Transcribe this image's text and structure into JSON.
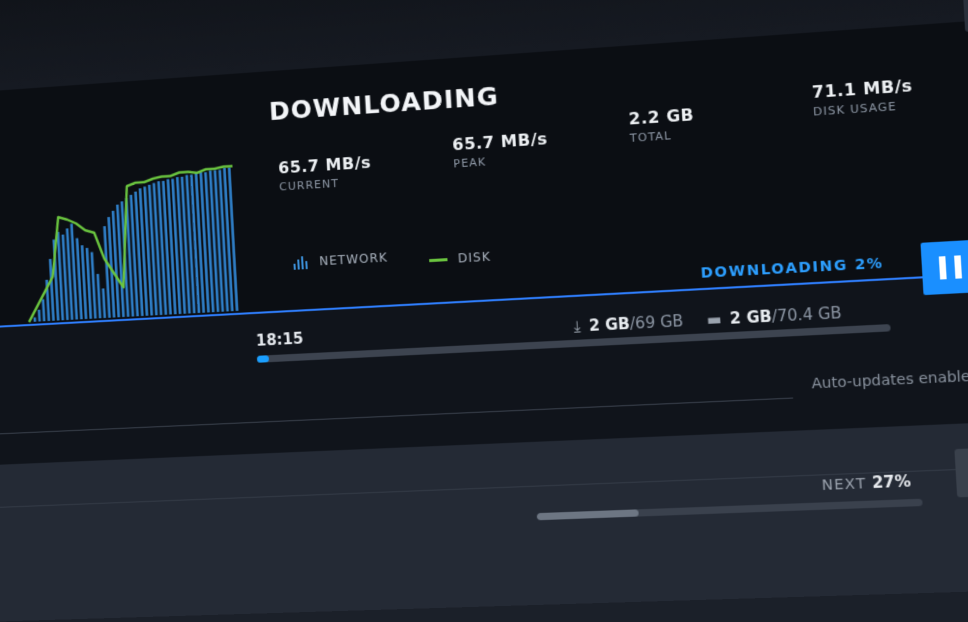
{
  "header": {
    "title": "DOWNLOADING"
  },
  "stats": [
    {
      "value": "65.7 MB/s",
      "label": "CURRENT"
    },
    {
      "value": "65.7 MB/s",
      "label": "PEAK"
    },
    {
      "value": "2.2 GB",
      "label": "TOTAL"
    },
    {
      "value": "71.1 MB/s",
      "label": "DISK USAGE"
    }
  ],
  "legend": {
    "network": "NETWORK",
    "disk": "DISK"
  },
  "colors": {
    "accent": "#1a9fff",
    "network_bars": "#3b8fd8",
    "disk_line": "#6ac43f",
    "graph_baseline": "#2f7fff"
  },
  "chart_data": {
    "type": "bar",
    "series": [
      {
        "name": "NETWORK",
        "values": [
          0,
          0.03,
          0.08,
          0.15,
          0.28,
          0.42,
          0.55,
          0.6,
          0.58,
          0.62,
          0.65,
          0.55,
          0.5,
          0.48,
          0.45,
          0.3,
          0.2,
          0.62,
          0.68,
          0.72,
          0.76,
          0.78,
          0.8,
          0.82,
          0.84,
          0.86,
          0.87,
          0.88,
          0.89,
          0.9,
          0.9,
          0.91,
          0.91,
          0.92,
          0.92,
          0.93,
          0.93,
          0.94,
          0.94,
          0.94,
          0.95,
          0.95,
          0.95,
          0.96,
          0.96
        ]
      },
      {
        "name": "DISK",
        "values": [
          0,
          0.1,
          0.2,
          0.3,
          0.7,
          0.68,
          0.65,
          0.6,
          0.58,
          0.4,
          0.3,
          0.2,
          0.88,
          0.9,
          0.9,
          0.92,
          0.93,
          0.93,
          0.95,
          0.95,
          0.94,
          0.96,
          0.96,
          0.97,
          0.97
        ]
      }
    ]
  },
  "download": {
    "status": "DOWNLOADING 2%",
    "progress": 0.02,
    "time_remaining": "18:15",
    "downloaded": "2 GB",
    "download_total": "/69 GB",
    "disk_written": "2 GB",
    "disk_total": "/70.4 GB",
    "download_icon": "download-icon",
    "disk_icon": "hard-drive-icon",
    "pause_icon": "pause-icon"
  },
  "auto_updates": "Auto-updates enabled",
  "next": {
    "label": "NEXT",
    "percent": "27%",
    "progress": 0.27,
    "button_icon": "download-icon"
  }
}
